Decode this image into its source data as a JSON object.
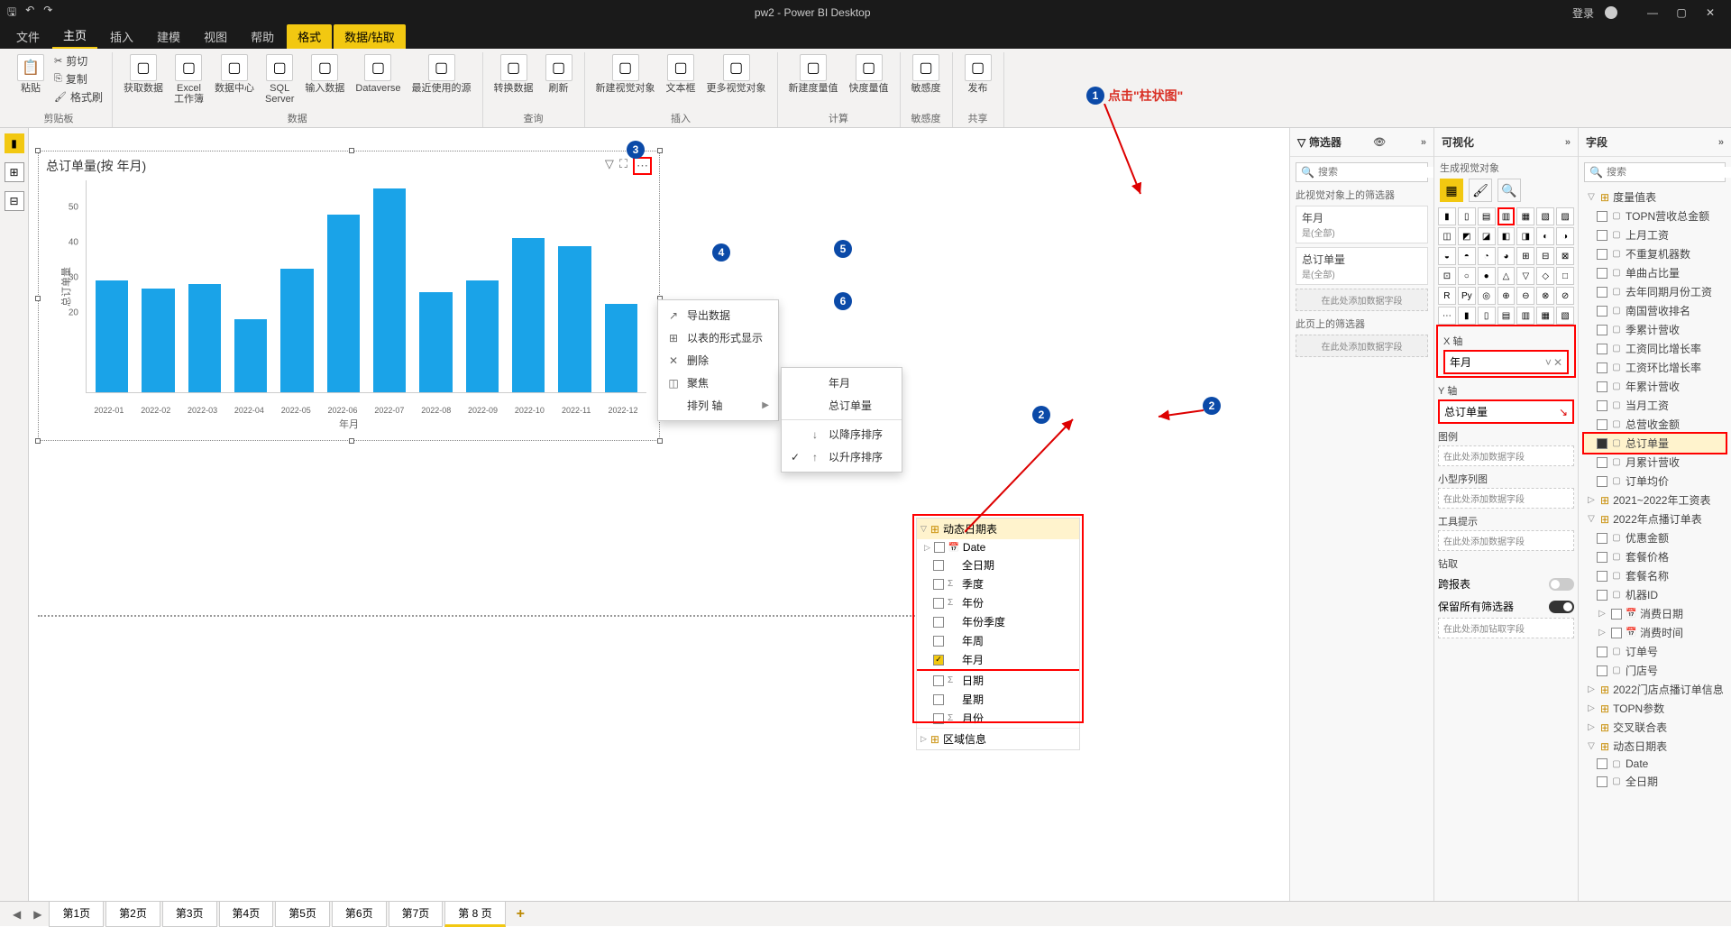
{
  "titlebar": {
    "title": "pw2 - Power BI Desktop",
    "login": "登录"
  },
  "ribbon_tabs": [
    "文件",
    "主页",
    "插入",
    "建模",
    "视图",
    "帮助",
    "格式",
    "数据/钻取"
  ],
  "ribbon_groups": {
    "clip": {
      "label": "剪贴板",
      "paste": "粘贴",
      "cut": "剪切",
      "copy": "复制",
      "brush": "格式刷"
    },
    "data": {
      "label": "数据",
      "btns": [
        "获取数据",
        "Excel\n工作簿",
        "数据中心",
        "SQL\nServer",
        "输入数据",
        "Dataverse",
        "最近使用的源"
      ]
    },
    "query": {
      "label": "查询",
      "btns": [
        "转换数据",
        "刷新"
      ]
    },
    "insert": {
      "label": "插入",
      "btns": [
        "新建视觉对象",
        "文本框",
        "更多视觉对象"
      ]
    },
    "calc": {
      "label": "计算",
      "btns": [
        "新建度量值",
        "快度量值"
      ]
    },
    "sense": {
      "label": "敏感度",
      "btns": [
        "敏感度"
      ]
    },
    "share": {
      "label": "共享",
      "btns": [
        "发布"
      ]
    }
  },
  "visual": {
    "title": "总订单量(按 年月)",
    "xlabel": "年月",
    "ylabel": "总订单量"
  },
  "chart_data": {
    "type": "bar",
    "categories": [
      "2022-01",
      "2022-02",
      "2022-03",
      "2022-04",
      "2022-05",
      "2022-06",
      "2022-07",
      "2022-08",
      "2022-09",
      "2022-10",
      "2022-11",
      "2022-12"
    ],
    "values": [
      29,
      27,
      28,
      19,
      32,
      46,
      53,
      26,
      29,
      40,
      38,
      23
    ],
    "title": "总订单量(按 年月)",
    "xlabel": "年月",
    "ylabel": "总订单量",
    "ylim": [
      0,
      55
    ],
    "yticks": [
      20,
      30,
      40,
      50
    ]
  },
  "menu1": [
    {
      "icon": "↗",
      "label": "导出数据"
    },
    {
      "icon": "⊞",
      "label": "以表的形式显示"
    },
    {
      "icon": "✕",
      "label": "删除"
    },
    {
      "icon": "◫",
      "label": "聚焦"
    },
    {
      "icon": "",
      "label": "排列 轴",
      "sub": true
    }
  ],
  "menu2": [
    {
      "chk": "",
      "label": "年月"
    },
    {
      "chk": "",
      "label": "总订单量"
    },
    {
      "sep": true
    },
    {
      "icon": "↓",
      "label": "以降序排序"
    },
    {
      "icon": "↑",
      "label": "以升序排序",
      "chk": "✓"
    }
  ],
  "filter_pane": {
    "title": "筛选器",
    "search": "搜索",
    "sec1": "此视觉对象上的筛选器",
    "cards": [
      {
        "t": "年月",
        "s": "是(全部)"
      },
      {
        "t": "总订单量",
        "s": "是(全部)"
      }
    ],
    "add1": "在此处添加数据字段",
    "sec2": "此页上的筛选器",
    "add2": "在此处添加数据字段"
  },
  "viz_pane": {
    "title": "可视化",
    "subtitle": "生成视觉对象",
    "labels": {
      "x": "X 轴",
      "y": "Y 轴",
      "legend": "图例",
      "small": "小型序列图",
      "tooltip": "工具提示",
      "drill": "钻取",
      "cross": "跨报表",
      "keep": "保留所有筛选器",
      "adddrill": "在此处添加钻取字段",
      "adddata": "在此处添加数据字段"
    },
    "x_val": "年月",
    "y_val": "总订单量"
  },
  "fields_pane": {
    "title": "字段",
    "search": "搜索",
    "tables": [
      {
        "name": "度量值表",
        "expand": true,
        "cols": [
          "TOPN营收总金额",
          "上月工资",
          "不重复机器数",
          "单曲占比量",
          "去年同期月份工资",
          "南国营收排名",
          "季累计营收",
          "工资同比增长率",
          "工资环比增长率",
          "年累计营收",
          "当月工资",
          "总营收金额",
          "总订单量",
          "月累计营收",
          "订单均价"
        ],
        "checked": [
          "总订单量"
        ]
      },
      {
        "name": "2021~2022年工资表",
        "expand": false
      },
      {
        "name": "2022年点播订单表",
        "expand": true,
        "cols": [
          "优惠金额",
          "套餐价格",
          "套餐名称",
          "机器ID",
          "消费日期",
          "消费时间",
          "订单号",
          "门店号"
        ],
        "date": [
          "消费日期",
          "消费时间"
        ]
      },
      {
        "name": "2022门店点播订单信息",
        "expand": false
      },
      {
        "name": "TOPN参数",
        "expand": false
      },
      {
        "name": "交叉联合表",
        "expand": false
      },
      {
        "name": "动态日期表",
        "expand": true,
        "cols": [
          "Date",
          "全日期"
        ],
        "sub_date": true
      }
    ]
  },
  "date_panel": {
    "title": "动态日期表",
    "items": [
      {
        "name": "Date",
        "type": "date",
        "expand": true
      },
      {
        "name": "全日期",
        "type": "col"
      },
      {
        "name": "季度",
        "type": "sum"
      },
      {
        "name": "年份",
        "type": "sum"
      },
      {
        "name": "年份季度",
        "type": "col"
      },
      {
        "name": "年周",
        "type": "col"
      },
      {
        "name": "年月",
        "type": "col",
        "checked": true
      },
      {
        "name": "日期",
        "type": "sum"
      },
      {
        "name": "星期",
        "type": "col"
      },
      {
        "name": "月份",
        "type": "sum"
      }
    ],
    "footer": "区域信息"
  },
  "annotations": {
    "a1": "点击\"柱状图\""
  },
  "sheets": [
    "第1页",
    "第2页",
    "第3页",
    "第4页",
    "第5页",
    "第6页",
    "第7页",
    "第 8 页"
  ]
}
